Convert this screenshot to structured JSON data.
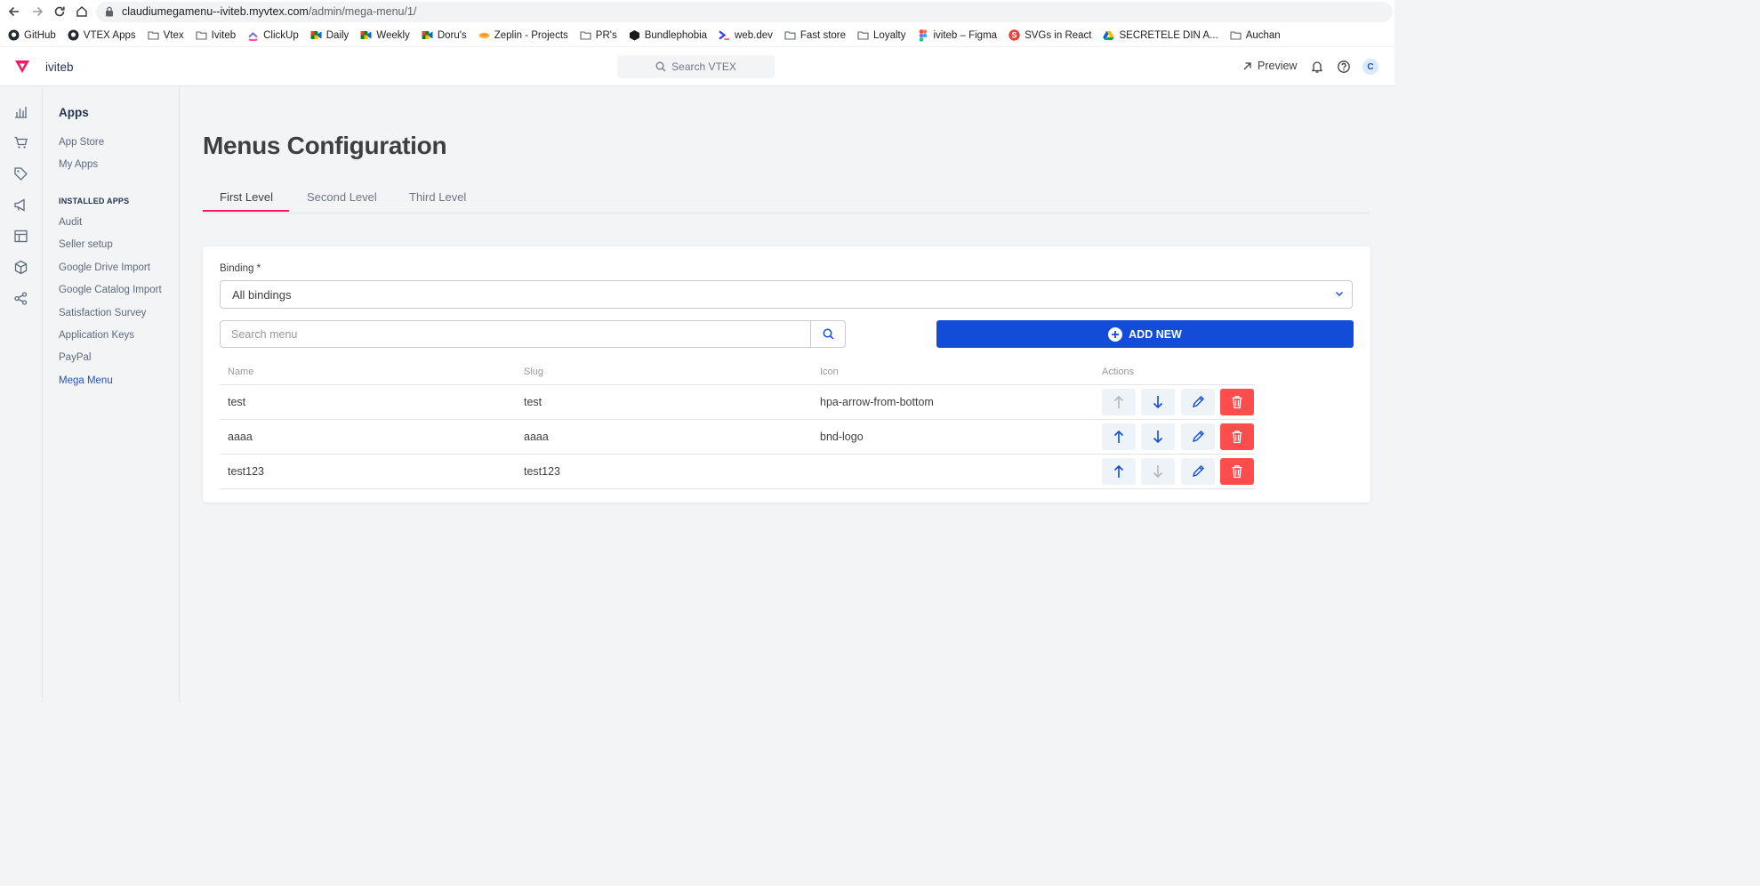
{
  "browser": {
    "url_host": "claudiumegamenu--iviteb.myvtex.com",
    "url_path": "/admin/mega-menu/1/",
    "bookmarks": [
      {
        "label": "GitHub",
        "icon": "github-icon"
      },
      {
        "label": "VTEX Apps",
        "icon": "github-icon"
      },
      {
        "label": "Vtex",
        "icon": "folder-icon"
      },
      {
        "label": "Iviteb",
        "icon": "folder-icon"
      },
      {
        "label": "ClickUp",
        "icon": "clickup-icon"
      },
      {
        "label": "Daily",
        "icon": "meet-icon"
      },
      {
        "label": "Weekly",
        "icon": "meet-icon"
      },
      {
        "label": "Doru's",
        "icon": "meet-icon"
      },
      {
        "label": "Zeplin - Projects",
        "icon": "zeplin-icon"
      },
      {
        "label": "PR's",
        "icon": "folder-icon"
      },
      {
        "label": "Bundlephobia",
        "icon": "box-icon"
      },
      {
        "label": "web.dev",
        "icon": "webdev-icon"
      },
      {
        "label": "Fast store",
        "icon": "folder-icon"
      },
      {
        "label": "Loyalty",
        "icon": "folder-icon"
      },
      {
        "label": "iviteb – Figma",
        "icon": "figma-icon"
      },
      {
        "label": "SVGs in React",
        "icon": "s-circle-icon"
      },
      {
        "label": "SECRETELE DIN A...",
        "icon": "drive-icon"
      },
      {
        "label": "Auchan",
        "icon": "folder-icon"
      }
    ]
  },
  "topbar": {
    "store_name": "iviteb",
    "search_label": "Search VTEX",
    "preview_label": "Preview",
    "avatar_initial": "C"
  },
  "sidenav": {
    "title": "Apps",
    "items": [
      "App Store",
      "My Apps"
    ],
    "section_label": "INSTALLED APPS",
    "installed": [
      "Audit",
      "Seller setup",
      "Google Drive Import",
      "Google Catalog Import",
      "Satisfaction Survey",
      "Application Keys",
      "PayPal",
      "Mega Menu"
    ],
    "active_item": "Mega Menu"
  },
  "main": {
    "title": "Menus Configuration",
    "tabs": [
      {
        "label": "First Level",
        "active": true
      },
      {
        "label": "Second Level",
        "active": false
      },
      {
        "label": "Third Level",
        "active": false
      }
    ],
    "binding_label": "Binding",
    "binding_required_mark": "*",
    "binding_value": "All bindings",
    "search_placeholder": "Search menu",
    "add_new_label": "ADD NEW",
    "columns": [
      "Name",
      "Slug",
      "Icon",
      "Actions"
    ],
    "rows": [
      {
        "name": "test",
        "slug": "test",
        "icon": "hpa-arrow-from-bottom",
        "up_enabled": false,
        "down_enabled": true
      },
      {
        "name": "aaaa",
        "slug": "aaaa",
        "icon": "bnd-logo",
        "up_enabled": true,
        "down_enabled": true
      },
      {
        "name": "test123",
        "slug": "test123",
        "icon": "",
        "up_enabled": true,
        "down_enabled": false
      }
    ]
  },
  "colors": {
    "accent_blue": "#134cd8",
    "tab_underline": "#f71963",
    "delete_red": "#ff4c4c",
    "vtex_pink": "#f71963",
    "active_link": "#2953b2"
  }
}
